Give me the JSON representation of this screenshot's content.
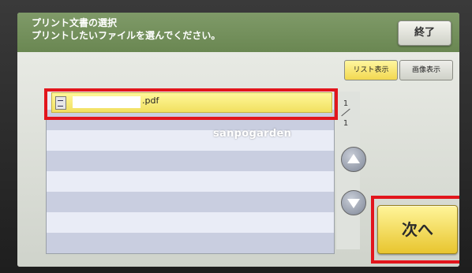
{
  "header": {
    "title": "プリント文書の選択",
    "instruction": "プリントしたいファイルを選んでください。",
    "end_button": "終了"
  },
  "view_tabs": {
    "list": "リスト表示",
    "image": "画像表示"
  },
  "file_list": {
    "selected_file_ext": ".pdf"
  },
  "pagination": {
    "current": "1",
    "total": "1"
  },
  "next_button": "次へ",
  "watermark": "sanpogarden",
  "icons": [
    "file-icon",
    "scroll-up-icon",
    "scroll-down-icon"
  ],
  "colors": {
    "header": "#7f9a68",
    "selected_row": "#fff89a",
    "highlight": "#e2151c",
    "next_button": "#f0d040"
  }
}
